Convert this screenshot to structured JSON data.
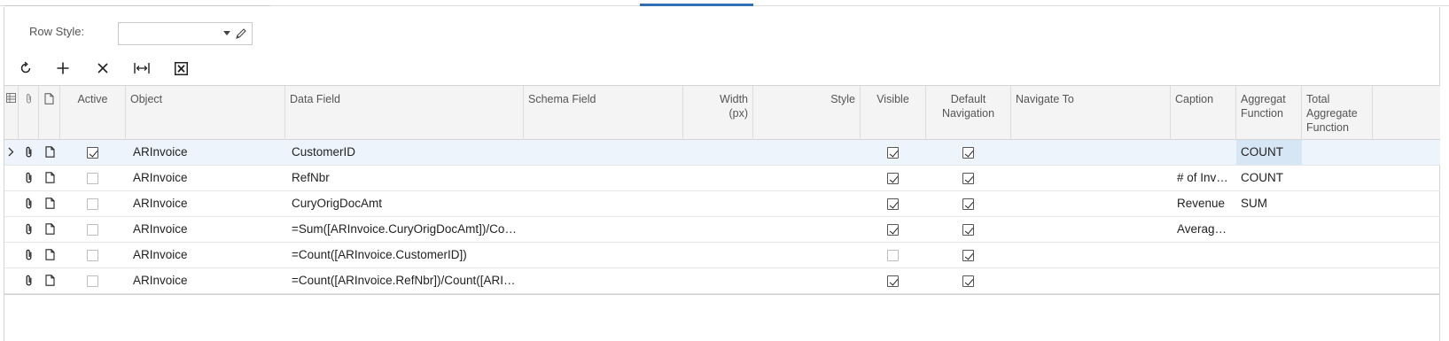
{
  "form": {
    "row_style_label": "Row Style:",
    "row_style_value": ""
  },
  "toolbar": {
    "buttons": [
      {
        "name": "refresh-button",
        "icon": "refresh-icon"
      },
      {
        "name": "add-row-button",
        "icon": "plus-icon"
      },
      {
        "name": "delete-row-button",
        "icon": "close-icon"
      },
      {
        "name": "fit-to-screen-button",
        "icon": "fit-width-icon"
      },
      {
        "name": "export-excel-button",
        "icon": "excel-icon"
      }
    ]
  },
  "grid": {
    "headers": {
      "active": "Active",
      "object": "Object",
      "data_field": "Data Field",
      "schema_field": "Schema Field",
      "width_line1": "Width",
      "width_line2": "(px)",
      "style": "Style",
      "visible": "Visible",
      "default_nav_line1": "Default",
      "default_nav_line2": "Navigation",
      "navigate_to": "Navigate To",
      "caption": "Caption",
      "agg_line1": "Aggregat",
      "agg_line2": "Function",
      "total_line1": "Total",
      "total_line2": "Aggregate",
      "total_line3": "Function"
    },
    "rows": [
      {
        "active": true,
        "object": "ARInvoice",
        "data_field": "CustomerID",
        "schema_field": "",
        "width": "",
        "style": "",
        "visible": true,
        "default_navigation": true,
        "navigate_to": "",
        "caption": "",
        "aggregate_function": "COUNT",
        "total_aggregate_function": "",
        "selected": true
      },
      {
        "active": false,
        "object": "ARInvoice",
        "data_field": "RefNbr",
        "schema_field": "",
        "width": "",
        "style": "",
        "visible": true,
        "default_navigation": true,
        "navigate_to": "",
        "caption": "# of Inv…",
        "aggregate_function": "COUNT",
        "total_aggregate_function": "",
        "selected": false
      },
      {
        "active": false,
        "object": "ARInvoice",
        "data_field": "CuryOrigDocAmt",
        "schema_field": "",
        "width": "",
        "style": "",
        "visible": true,
        "default_navigation": true,
        "navigate_to": "",
        "caption": "Revenue",
        "aggregate_function": "SUM",
        "total_aggregate_function": "",
        "selected": false
      },
      {
        "active": false,
        "object": "ARInvoice",
        "data_field": "=Sum([ARInvoice.CuryOrigDocAmt])/Count…",
        "schema_field": "",
        "width": "",
        "style": "",
        "visible": true,
        "default_navigation": true,
        "navigate_to": "",
        "caption": "Averag…",
        "aggregate_function": "",
        "total_aggregate_function": "",
        "selected": false
      },
      {
        "active": false,
        "object": "ARInvoice",
        "data_field": "=Count([ARInvoice.CustomerID])",
        "schema_field": "",
        "width": "",
        "style": "",
        "visible": false,
        "default_navigation": true,
        "navigate_to": "",
        "caption": "",
        "aggregate_function": "",
        "total_aggregate_function": "",
        "selected": false
      },
      {
        "active": false,
        "object": "ARInvoice",
        "data_field": "=Count([ARInvoice.RefNbr])/Count([ARInvo…",
        "schema_field": "",
        "width": "",
        "style": "",
        "visible": true,
        "default_navigation": true,
        "navigate_to": "",
        "caption": "",
        "aggregate_function": "",
        "total_aggregate_function": "",
        "selected": false
      }
    ]
  },
  "colors": {
    "accent": "#2f6fb4",
    "selected_row": "#eef4fb",
    "active_cell": "#d6e6f5",
    "header_bg": "#f4f4f4"
  }
}
